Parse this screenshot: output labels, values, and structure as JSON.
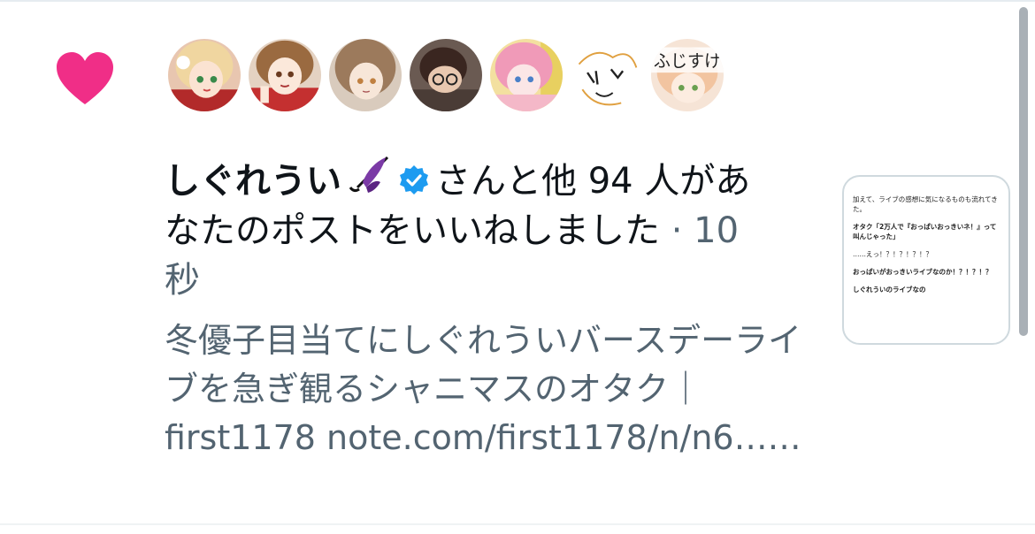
{
  "notification": {
    "type": "like",
    "heart_color": "#f91880",
    "user_name": "しぐれうい",
    "user_badge_emoji": "closed-umbrella",
    "verified_color": "#1d9bf0",
    "action_text": "さんと他 94 人があなたのポストをいいねしました",
    "separator": "·",
    "time": "10 秒"
  },
  "avatars": [
    {
      "name": "avatar-1"
    },
    {
      "name": "avatar-2"
    },
    {
      "name": "avatar-3"
    },
    {
      "name": "avatar-4"
    },
    {
      "name": "avatar-5"
    },
    {
      "name": "avatar-6"
    },
    {
      "name": "avatar-7",
      "overlay_text": "ふじすけ"
    }
  ],
  "post_preview": {
    "text": "冬優子目当てにしぐれういバースデーライブを急ぎ観るシャニマスのオタク｜first1178 note.com/first1178/n/n6……"
  },
  "thumbnail": {
    "lines": [
      "加えて、ライブの感想に気になるものも流れてきた。",
      "オタク「2万人で『おっぱいおっきいネ！』って叫んじゃった」",
      "……えっ！？！？！？！？",
      "おっぱいがおっきいライブなのか！？！？！？",
      "しぐれういのライブなの"
    ]
  }
}
